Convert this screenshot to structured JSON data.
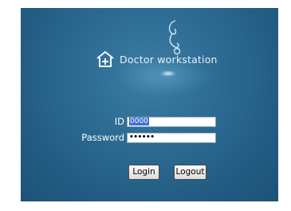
{
  "brand": {
    "title": "Doctor workstation",
    "logo_icon": "home-plus-icon",
    "decoration_icon": "stethoscope-icon"
  },
  "form": {
    "id_label": "ID",
    "id_value": "0000",
    "password_label": "Password",
    "password_value": "••••••"
  },
  "buttons": {
    "login": "Login",
    "logout": "Logout"
  },
  "colors": {
    "background": "#2e6d95",
    "selection": "#3a6fd6"
  }
}
